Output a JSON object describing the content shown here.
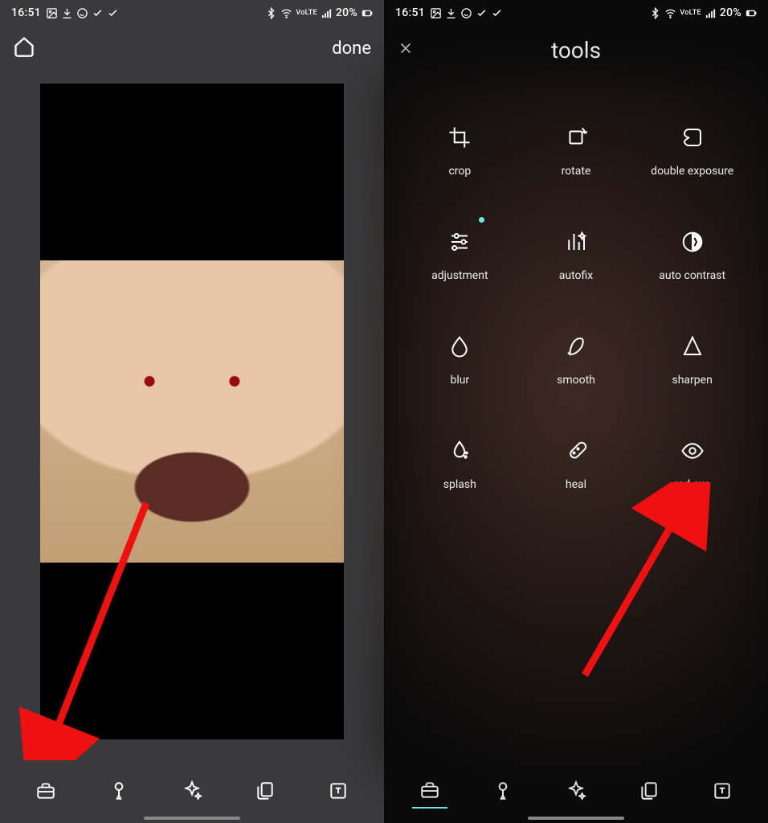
{
  "status": {
    "time": "16:51",
    "battery": "20%"
  },
  "left": {
    "done": "done"
  },
  "right": {
    "title": "tools",
    "tools": [
      {
        "label": "crop"
      },
      {
        "label": "rotate"
      },
      {
        "label": "double exposure"
      },
      {
        "label": "adjustment"
      },
      {
        "label": "autofix"
      },
      {
        "label": "auto contrast"
      },
      {
        "label": "blur"
      },
      {
        "label": "smooth"
      },
      {
        "label": "sharpen"
      },
      {
        "label": "splash"
      },
      {
        "label": "heal"
      },
      {
        "label": "red eye"
      }
    ]
  }
}
